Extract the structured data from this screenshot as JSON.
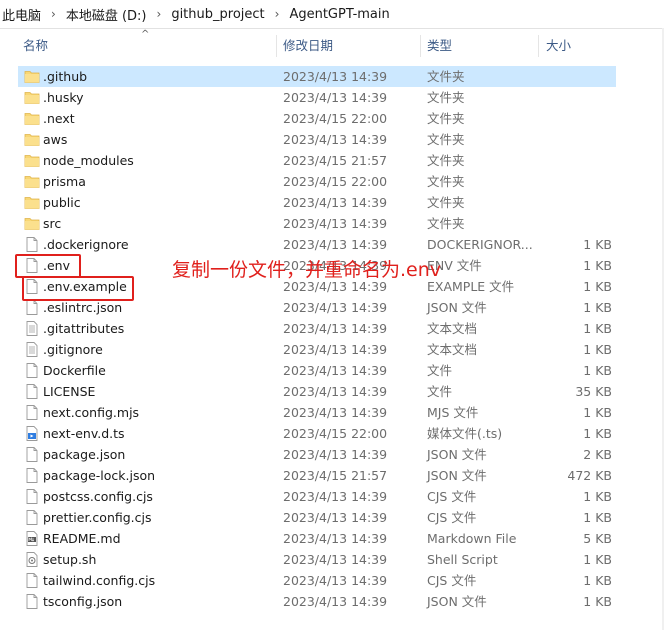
{
  "breadcrumb": [
    "此电脑",
    "本地磁盘 (D:)",
    "github_project",
    "AgentGPT-main"
  ],
  "columns": {
    "name": "名称",
    "date": "修改日期",
    "type": "类型",
    "size": "大小"
  },
  "files": [
    {
      "name": ".github",
      "date": "2023/4/13 14:39",
      "type": "文件夹",
      "size": "",
      "icon": "folder-icon",
      "selected": true
    },
    {
      "name": ".husky",
      "date": "2023/4/13 14:39",
      "type": "文件夹",
      "size": "",
      "icon": "folder-icon"
    },
    {
      "name": ".next",
      "date": "2023/4/15 22:00",
      "type": "文件夹",
      "size": "",
      "icon": "folder-icon"
    },
    {
      "name": "aws",
      "date": "2023/4/13 14:39",
      "type": "文件夹",
      "size": "",
      "icon": "folder-icon"
    },
    {
      "name": "node_modules",
      "date": "2023/4/15 21:57",
      "type": "文件夹",
      "size": "",
      "icon": "folder-icon"
    },
    {
      "name": "prisma",
      "date": "2023/4/15 22:00",
      "type": "文件夹",
      "size": "",
      "icon": "folder-icon"
    },
    {
      "name": "public",
      "date": "2023/4/13 14:39",
      "type": "文件夹",
      "size": "",
      "icon": "folder-icon"
    },
    {
      "name": "src",
      "date": "2023/4/13 14:39",
      "type": "文件夹",
      "size": "",
      "icon": "folder-icon"
    },
    {
      "name": ".dockerignore",
      "date": "2023/4/13 14:39",
      "type": "DOCKERIGNOR...",
      "size": "1 KB",
      "icon": "file-icon"
    },
    {
      "name": ".env",
      "date": "2023/4/13 14:39",
      "type": "ENV 文件",
      "size": "1 KB",
      "icon": "file-icon"
    },
    {
      "name": ".env.example",
      "date": "2023/4/13 14:39",
      "type": "EXAMPLE 文件",
      "size": "1 KB",
      "icon": "file-icon"
    },
    {
      "name": ".eslintrc.json",
      "date": "2023/4/13 14:39",
      "type": "JSON 文件",
      "size": "1 KB",
      "icon": "file-icon"
    },
    {
      "name": ".gitattributes",
      "date": "2023/4/13 14:39",
      "type": "文本文档",
      "size": "1 KB",
      "icon": "text-file-icon"
    },
    {
      "name": ".gitignore",
      "date": "2023/4/13 14:39",
      "type": "文本文档",
      "size": "1 KB",
      "icon": "text-file-icon"
    },
    {
      "name": "Dockerfile",
      "date": "2023/4/13 14:39",
      "type": "文件",
      "size": "1 KB",
      "icon": "file-icon"
    },
    {
      "name": "LICENSE",
      "date": "2023/4/13 14:39",
      "type": "文件",
      "size": "35 KB",
      "icon": "file-icon"
    },
    {
      "name": "next.config.mjs",
      "date": "2023/4/13 14:39",
      "type": "MJS 文件",
      "size": "1 KB",
      "icon": "file-icon"
    },
    {
      "name": "next-env.d.ts",
      "date": "2023/4/15 22:00",
      "type": "媒体文件(.ts)",
      "size": "1 KB",
      "icon": "media-file-icon"
    },
    {
      "name": "package.json",
      "date": "2023/4/13 14:39",
      "type": "JSON 文件",
      "size": "2 KB",
      "icon": "file-icon"
    },
    {
      "name": "package-lock.json",
      "date": "2023/4/15 21:57",
      "type": "JSON 文件",
      "size": "472 KB",
      "icon": "file-icon"
    },
    {
      "name": "postcss.config.cjs",
      "date": "2023/4/13 14:39",
      "type": "CJS 文件",
      "size": "1 KB",
      "icon": "file-icon"
    },
    {
      "name": "prettier.config.cjs",
      "date": "2023/4/13 14:39",
      "type": "CJS 文件",
      "size": "1 KB",
      "icon": "file-icon"
    },
    {
      "name": "README.md",
      "date": "2023/4/13 14:39",
      "type": "Markdown File",
      "size": "5 KB",
      "icon": "markdown-file-icon"
    },
    {
      "name": "setup.sh",
      "date": "2023/4/13 14:39",
      "type": "Shell Script",
      "size": "1 KB",
      "icon": "shell-script-icon"
    },
    {
      "name": "tailwind.config.cjs",
      "date": "2023/4/13 14:39",
      "type": "CJS 文件",
      "size": "1 KB",
      "icon": "file-icon"
    },
    {
      "name": "tsconfig.json",
      "date": "2023/4/13 14:39",
      "type": "JSON 文件",
      "size": "1 KB",
      "icon": "file-icon"
    }
  ],
  "annotation": {
    "text": "复制一份文件，并重命名为.env",
    "color": "#e0201c"
  },
  "colors": {
    "selection": "#cce8ff",
    "folder": "#f8d775",
    "header_text": "#3c5a86"
  }
}
